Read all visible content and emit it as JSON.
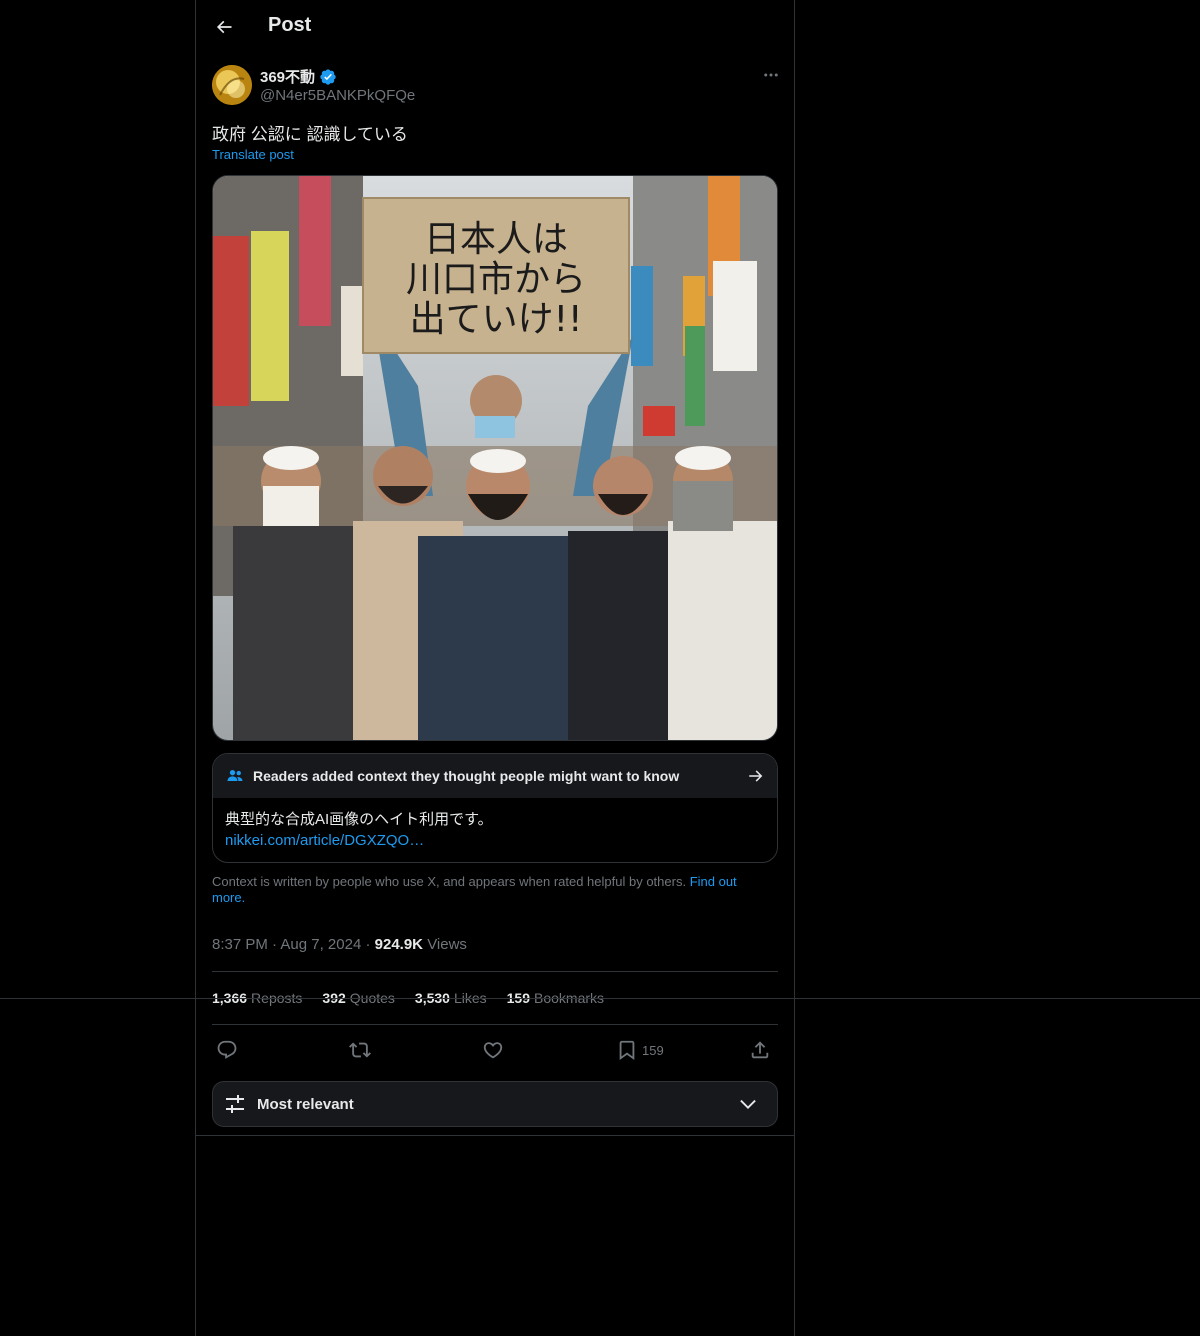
{
  "header": {
    "title": "Post"
  },
  "author": {
    "display_name": "369不動",
    "handle": "@N4er5BANKPkQFQe",
    "verified": true
  },
  "post": {
    "text": "政府 公認に 認識している",
    "translate_label": "Translate post",
    "image_alt_sign_text": [
      "日本人は",
      "川口市から",
      "出ていけ!!"
    ]
  },
  "community_note": {
    "heading": "Readers added context they thought people might want to know",
    "text": "典型的な合成AI画像のヘイト利用です。",
    "link": "nikkei.com/article/DGXZQO…",
    "footer_text": "Context is written by people who use X, and appears when rated helpful by others.",
    "footer_link": "Find out more."
  },
  "meta": {
    "time": "8:37 PM",
    "date": "Aug 7, 2024",
    "views_count": "924.9K",
    "views_label": "Views"
  },
  "stats": {
    "reposts_count": "1,366",
    "reposts_label": "Reposts",
    "quotes_count": "392",
    "quotes_label": "Quotes",
    "likes_count": "3,530",
    "likes_label": "Likes",
    "bookmarks_count": "159",
    "bookmarks_label": "Bookmarks"
  },
  "actions": {
    "reply_icon": "reply-icon",
    "repost_icon": "repost-icon",
    "like_icon": "heart-icon",
    "bookmark_icon": "bookmark-icon",
    "bookmark_count": "159",
    "share_icon": "share-icon"
  },
  "replies_sort": {
    "label": "Most relevant"
  },
  "colors": {
    "accent": "#1d9bf0",
    "border": "#2f3336",
    "muted": "#71767b",
    "text": "#e7e9ea",
    "background": "#000000"
  }
}
